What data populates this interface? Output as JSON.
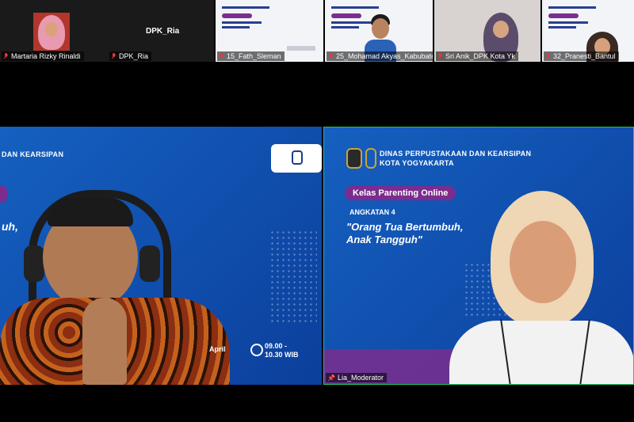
{
  "top_row": [
    {
      "name": "Martaria Rizky Rinaldi",
      "muted": true
    },
    {
      "name": "DPK_Ria",
      "muted": true,
      "display_name": "DPK_Ria"
    },
    {
      "name": "15_Fath_Sleman",
      "muted": true
    },
    {
      "name": "25_Mohamad Akyas_Kabubaten...",
      "muted": true
    },
    {
      "name": "Sri Anik_DPK Kota Yk",
      "muted": true
    },
    {
      "name": "32_Pranesti_Bantul",
      "muted": true
    }
  ],
  "mini_slide": {
    "pill": "Kelas Parenting Online",
    "line1": "ANGKATAN 4",
    "quote": "\"Orang Tua Bertumbuh, Anak Tangguh\""
  },
  "left_tile": {
    "slide_header": "DAN KEARSIPAN",
    "slide_fragment": "uh,",
    "date_fragment": "April",
    "time": "09.00 - 10.30 WIB"
  },
  "right_tile": {
    "header_line1": "DINAS PERPUSTAKAAN DAN KEARSIPAN",
    "header_line2": "KOTA YOGYAKARTA",
    "pill": "Kelas Parenting Online",
    "subtitle": "ANGKATAN 4",
    "quote_line1": "\"Orang Tua Bertumbuh,",
    "quote_line2": "Anak Tangguh\"",
    "participant_name": "Lia_Moderator"
  },
  "colors": {
    "accent_border": "#22c55e",
    "pill": "#7b2d8e",
    "slide_blue": "#1565c0",
    "mute_red": "#e33333"
  },
  "icons": [
    "muted-mic-icon",
    "pin-icon",
    "clock-icon",
    "org-logo-icon"
  ]
}
